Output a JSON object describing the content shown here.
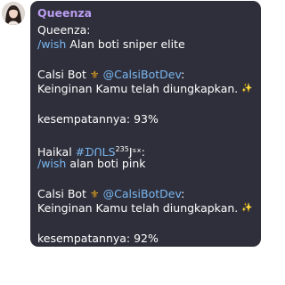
{
  "colors": {
    "bubble_bg": "#2f2f3b",
    "sender": "#b99cf0",
    "link": "#79b8f2",
    "text": "#ffffff",
    "trident": "#e4a21c",
    "sparkle": "#f5c842"
  },
  "message": {
    "sender": "Queenza",
    "lines": {
      "l1_name": "Queenza:",
      "l2_cmd": "/wish",
      "l2_text": " Alan boti sniper elite",
      "l3_name": "Calsi Bot ",
      "l3_icon": "⚜",
      "l3_mention": " @CalsiBotDev",
      "l3_colon": ":",
      "l4_text": "Keinginan Kamu telah diungkapkan. ",
      "l4_icon": "✨",
      "l5_text": "kesempatannya: 93%",
      "l6_name": "Haikal ",
      "l6_hash": "#ᗪᑎᒪS",
      "l6_sup": "235",
      "l6_tail": "Jˢˣ:",
      "l7_cmd": "/wish",
      "l7_text": " alan boti pink",
      "l8_name": "Calsi Bot ",
      "l8_icon": "⚜",
      "l8_mention": " @CalsiBotDev",
      "l8_colon": ":",
      "l9_text": "Keinginan Kamu telah diungkapkan. ",
      "l9_icon": "✨",
      "l10_text": "kesempatannya: 92%"
    }
  },
  "icons": {
    "avatar": "avatar-photo",
    "trident": "trident-icon",
    "sparkle": "sparkles-icon"
  }
}
